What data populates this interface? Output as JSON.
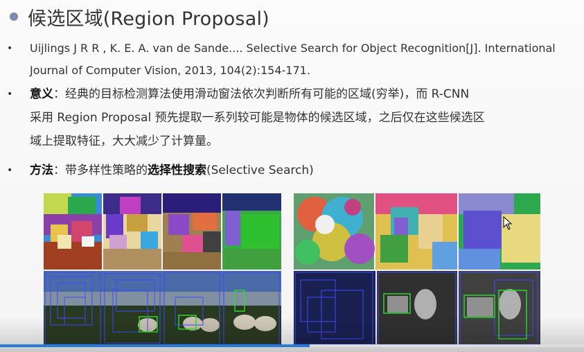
{
  "title": "候选区域(Region Proposal)",
  "bullets": {
    "dot": "•",
    "ref_line1": "Uijlings J R R , K. E. A. van de Sande.... Selective Search for Object Recognition[J]. International",
    "ref_line2": "Journal of Computer Vision, 2013, 104(2):154-171.",
    "meaning_label": "意义",
    "meaning_line1": "：经典的目标检测算法使用滑动窗法依次判断所有可能的区域(穷举)，而 R-CNN",
    "meaning_line2": "采用 Region Proposal 预先提取一系列较可能是物体的候选区域，之后仅在这些候选区",
    "meaning_line3": "域上提取特征，大大减少了计算量。",
    "method_label": "方法",
    "method_text": "：带多样性策略的",
    "method_bold": "选择性搜索",
    "method_tail": "(Selective Search)"
  },
  "progress": 0.53,
  "colors": {
    "progress": "#2a7bd6",
    "bbox_blue": "#3a4cff",
    "bbox_green": "#2bd82b"
  },
  "icons": {
    "cursor": "mouse-pointer-icon"
  }
}
